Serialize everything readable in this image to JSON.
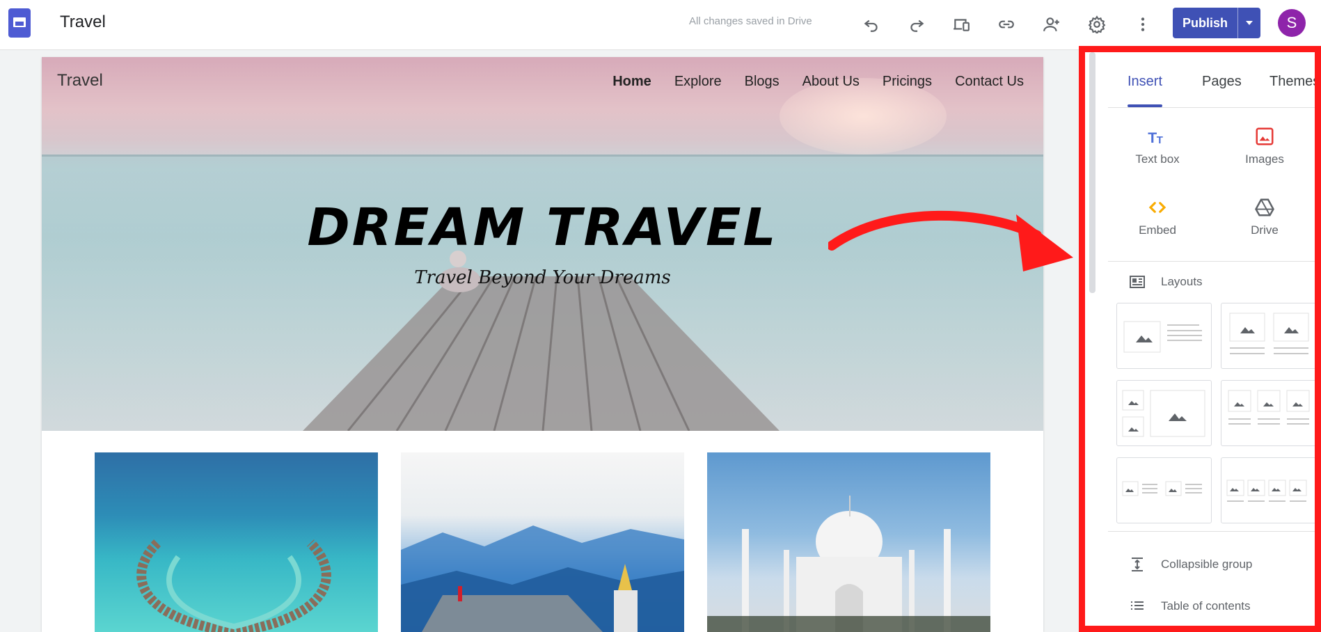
{
  "app": {
    "doc_title": "Travel",
    "save_status": "All changes saved in Drive",
    "publish_label": "Publish",
    "avatar_letter": "S"
  },
  "toolbar_icons": [
    "undo-icon",
    "redo-icon",
    "preview-device-icon",
    "link-icon",
    "add-person-icon",
    "settings-icon",
    "more-vert-icon"
  ],
  "site": {
    "logo": "Travel",
    "nav": [
      "Home",
      "Explore",
      "Blogs",
      "About Us",
      "Pricings",
      "Contact Us"
    ],
    "active_nav": "Home",
    "hero_title": "DREAM TRAVEL",
    "hero_subtitle": "Travel Beyond Your Dreams"
  },
  "panel": {
    "tabs": [
      "Insert",
      "Pages",
      "Themes"
    ],
    "active_tab": "Insert",
    "insert_items": [
      {
        "label": "Text box",
        "icon": "text-box-icon",
        "color": "#4e6fd8"
      },
      {
        "label": "Images",
        "icon": "image-icon",
        "color": "#e53935"
      },
      {
        "label": "Embed",
        "icon": "embed-icon",
        "color": "#f9ab00"
      },
      {
        "label": "Drive",
        "icon": "drive-icon",
        "color": "#5f6368"
      }
    ],
    "layouts_label": "Layouts",
    "list_items": [
      {
        "label": "Collapsible group",
        "icon": "collapsible-group-icon"
      },
      {
        "label": "Table of contents",
        "icon": "table-of-contents-icon"
      }
    ]
  },
  "colors": {
    "accent": "#3f51b5",
    "highlight": "#ff1a1a",
    "avatar": "#8e24aa"
  }
}
